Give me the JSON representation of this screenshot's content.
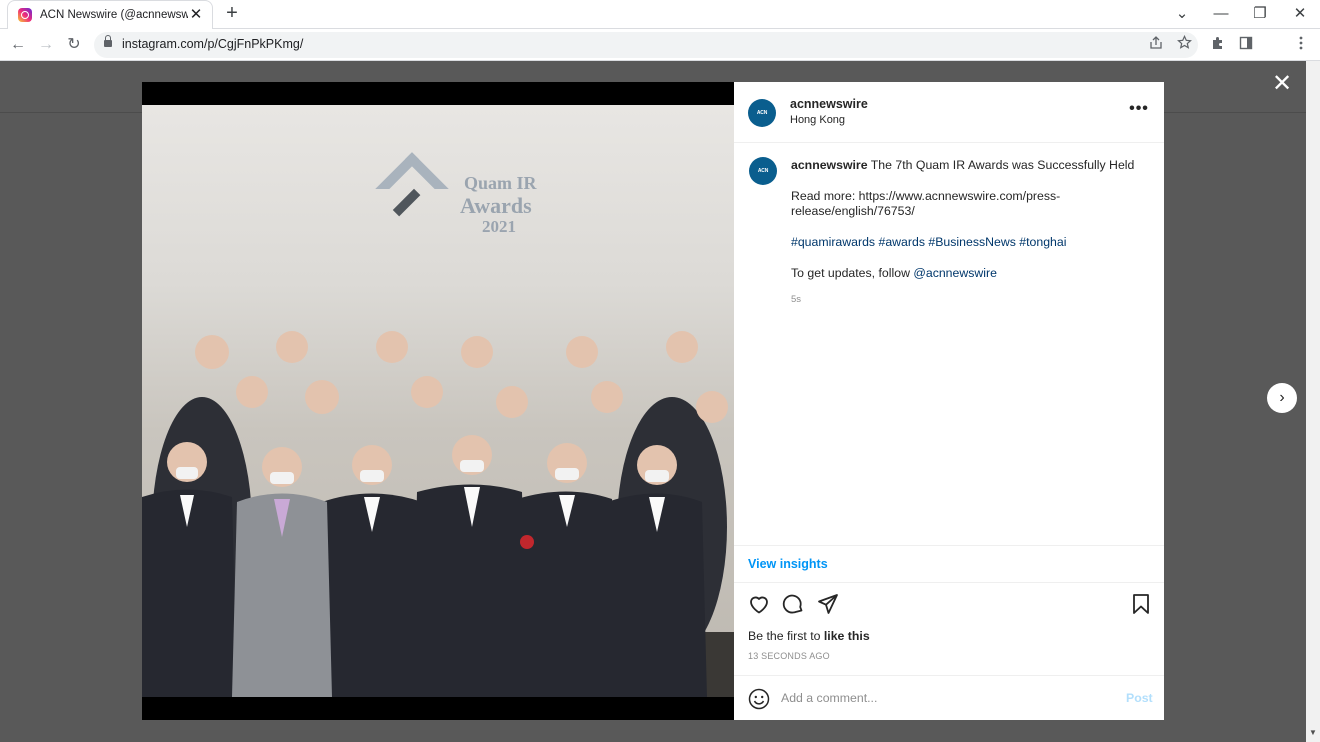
{
  "browser": {
    "tab_title": "ACN Newswire (@acnnewswire) ·",
    "tab_close": "✕",
    "new_tab": "+",
    "url": "instagram.com/p/CgjFnPkPKmg/",
    "controls": {
      "tab_search": "⌄",
      "minimize": "—",
      "restore": "❐",
      "close": "✕"
    },
    "nav": {
      "back": "←",
      "forward": "→",
      "reload": "↻"
    }
  },
  "post": {
    "username": "acnnewswire",
    "location": "Hong Kong",
    "avatar_text": "ACN NEWSWIRE",
    "more_label": "•••",
    "caption": {
      "title": "The 7th Quam IR Awards was Successfully Held",
      "read_more": "Read more: https://www.acnnewswire.com/press-release/english/76753/",
      "hashtags": "#quamirawards #awards #BusinessNews #tonghai",
      "follow_text": "To get updates, follow ",
      "follow_handle": "@acnnewswire"
    },
    "age": "5s",
    "photo_text": {
      "line1": "Quam IR",
      "line2": "Awards",
      "line3": "2021"
    },
    "insights_label": "View insights",
    "likes_prefix": "Be the first to ",
    "likes_action": "like this",
    "timestamp": "13 SECONDS AGO",
    "comment_placeholder": "Add a comment...",
    "post_label": "Post"
  },
  "modal": {
    "close": "✕",
    "next": "›"
  },
  "colors": {
    "link": "#00376b",
    "accent": "#0095f6",
    "post_disabled": "#b2dffc",
    "avatar_bg": "#0a5e8e"
  }
}
